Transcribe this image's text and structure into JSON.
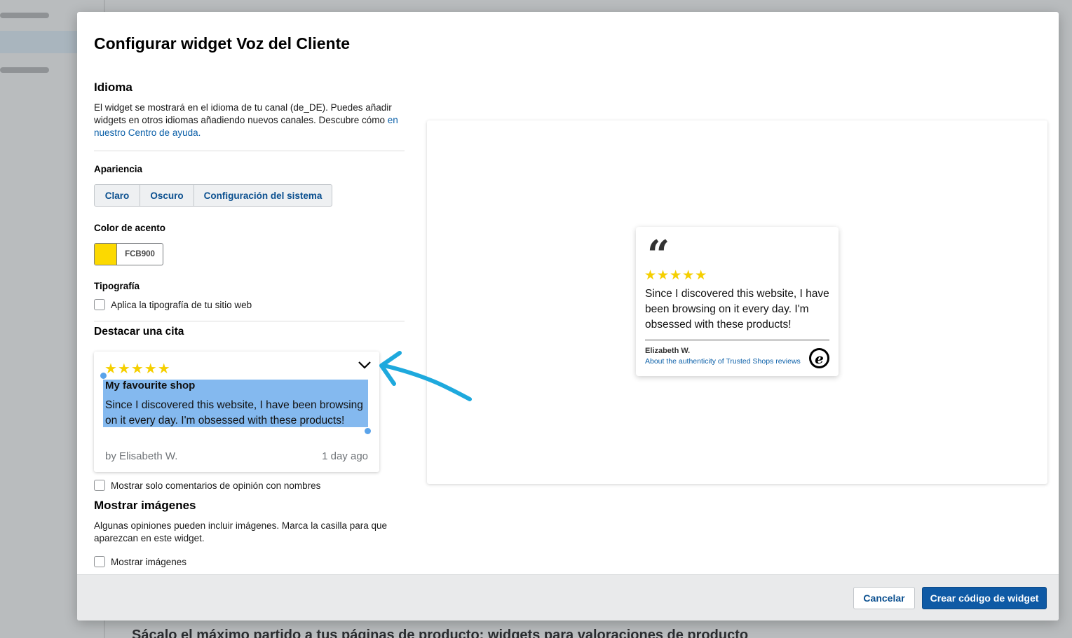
{
  "background": {
    "heading": "Sácalo el máximo partido a tus páginas de producto: widgets para valoraciones de producto"
  },
  "modal": {
    "title": "Configurar widget Voz del Cliente"
  },
  "language": {
    "heading": "Idioma",
    "description": "El widget se mostrará en el idioma de tu canal (de_DE). Puedes añadir widgets en otros idiomas añadiendo nuevos canales. Descubre cómo",
    "link": "en nuestro Centro de ayuda."
  },
  "appearance": {
    "label": "Apariencia",
    "options": [
      "Claro",
      "Oscuro",
      "Configuración del sistema"
    ]
  },
  "accent_color": {
    "label": "Color de acento",
    "value": "FCB900",
    "swatch_color": "#FCD900"
  },
  "typography": {
    "label": "Tipografía",
    "checkbox_label": "Aplica la tipografía de tu sitio web"
  },
  "highlight_quote": {
    "heading": "Destacar una cita",
    "stars": "★★★★★",
    "title": "My favourite shop",
    "text": "Since I discovered this website, I have been browsing on it every day. I'm obsessed with these products!",
    "author": "by Elisabeth W.",
    "date": "1 day ago",
    "names_only_label": "Mostrar solo comentarios de opinión con nombres"
  },
  "images": {
    "heading": "Mostrar imágenes",
    "description": "Algunas opiniones pueden incluir imágenes. Marca la casilla para que aparezcan en este widget.",
    "checkbox_label": "Mostrar imágenes"
  },
  "preview": {
    "quote_mark": "“",
    "stars": "★★★★★",
    "text": "Since I discovered this website, I have been browsing on it every day. I'm obsessed with these products!",
    "author": "Elizabeth W.",
    "link": "About the authenticity of Trusted Shops reviews",
    "badge": "e"
  },
  "footer": {
    "cancel": "Cancelar",
    "create": "Crear código de widget"
  }
}
